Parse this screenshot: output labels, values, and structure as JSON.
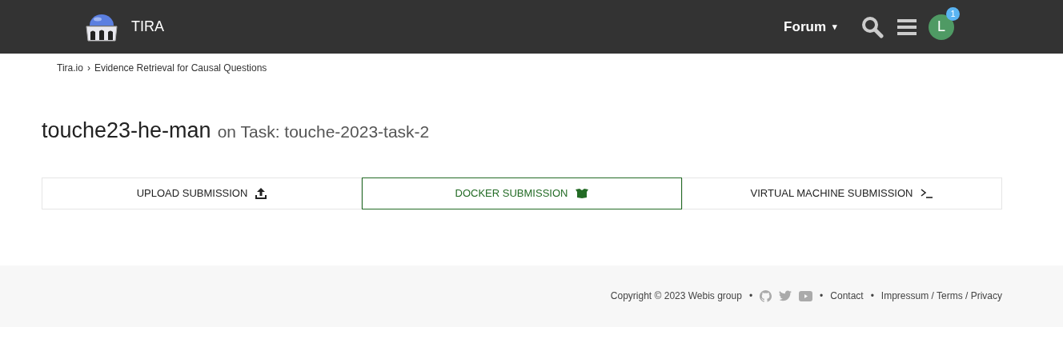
{
  "header": {
    "brand": "TIRA",
    "menu": "Forum",
    "menu_caret": "▾",
    "avatar": {
      "initial": "L",
      "badge": "1"
    }
  },
  "breadcrumb": [
    {
      "label": "Tira.io"
    },
    {
      "label": "Evidence Retrieval for Causal Questions"
    }
  ],
  "breadcrumb_separator": "›",
  "title": {
    "name": "touche23-he-man",
    "subtitle": "on Task: touche-2023-task-2"
  },
  "tabs": [
    {
      "label": "UPLOAD SUBMISSION",
      "kind": "upload",
      "selected": false
    },
    {
      "label": "DOCKER SUBMISSION",
      "kind": "docker",
      "selected": true
    },
    {
      "label": "VIRTUAL MACHINE SUBMISSION",
      "kind": "terminal",
      "selected": false
    }
  ],
  "footer": {
    "copyright": "Copyright © 2023 Webis group",
    "bullet": "•",
    "links": [
      "Contact",
      "Impressum / Terms / Privacy"
    ]
  }
}
